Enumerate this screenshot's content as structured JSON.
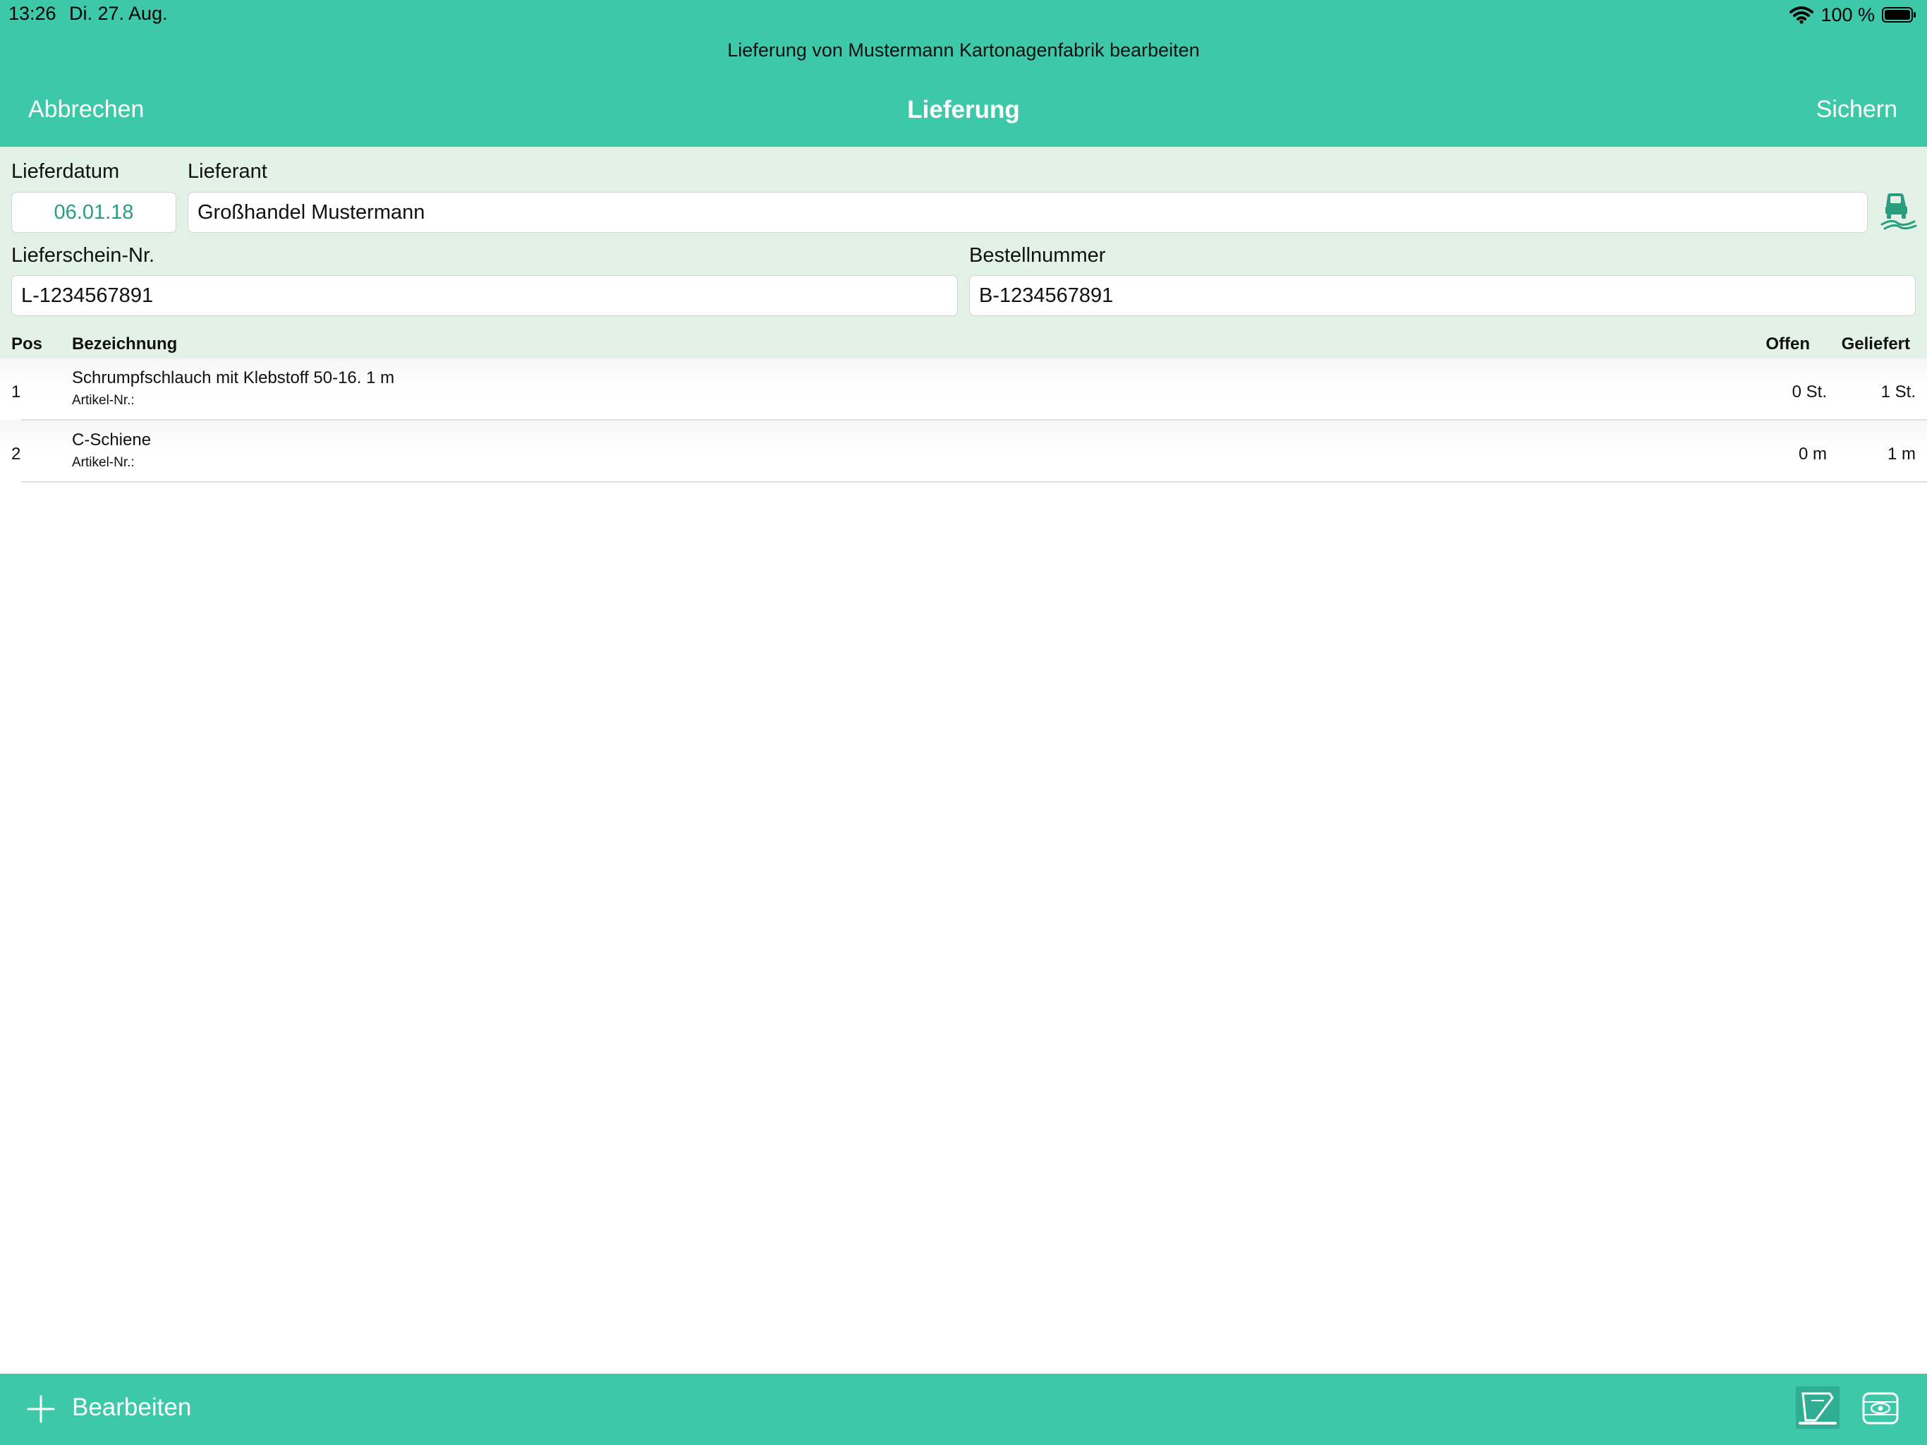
{
  "status": {
    "time": "13:26",
    "date": "Di. 27. Aug.",
    "battery": "100 %"
  },
  "header": {
    "subtitle": "Lieferung von Mustermann Kartonagenfabrik bearbeiten",
    "title": "Lieferung",
    "cancel_label": "Abbrechen",
    "save_label": "Sichern"
  },
  "form": {
    "date_label": "Lieferdatum",
    "date_value": "06.01.18",
    "supplier_label": "Lieferant",
    "supplier_value": "Großhandel Mustermann",
    "delivery_note_label": "Lieferschein-Nr.",
    "delivery_note_value": "L-1234567891",
    "order_number_label": "Bestellnummer",
    "order_number_value": "B-1234567891"
  },
  "table": {
    "headers": {
      "pos": "Pos",
      "name": "Bezeichnung",
      "open": "Offen",
      "delivered": "Geliefert"
    },
    "rows": [
      {
        "pos": "1",
        "name": "Schrumpfschlauch mit Klebstoff 50-16. 1 m",
        "article": "Artikel-Nr.:",
        "open": "0 St.",
        "delivered": "1 St."
      },
      {
        "pos": "2",
        "name": "C-Schiene",
        "article": "Artikel-Nr.:",
        "open": "0 m",
        "delivered": "1 m"
      }
    ]
  },
  "footer": {
    "edit_label": "Bearbeiten"
  },
  "icons": {
    "wifi": "wifi-icon",
    "battery": "battery-icon",
    "truck": "truck-icon",
    "add": "plus-icon",
    "scan": "scanner-icon",
    "view": "view-icon"
  },
  "colors": {
    "accent": "#3dc8aa",
    "form_background": "#e3f2e6",
    "date_text": "#2a9d7f"
  }
}
